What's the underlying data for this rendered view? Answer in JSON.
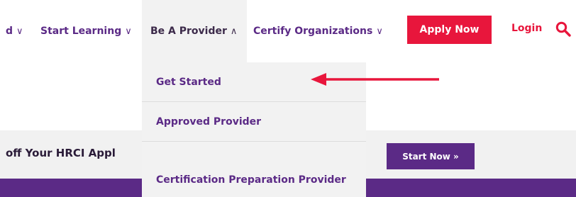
{
  "nav": {
    "items": [
      {
        "label": "d",
        "chevron": "∨"
      },
      {
        "label": "Start Learning",
        "chevron": "∨"
      },
      {
        "label": "Be A Provider",
        "chevron": "∧"
      },
      {
        "label": "Certify Organizations",
        "chevron": "∨"
      }
    ],
    "apply_label": "Apply Now",
    "login_label": "Login",
    "search_icon": "search-icon"
  },
  "dropdown": {
    "items": [
      {
        "label": "Get Started"
      },
      {
        "label": "Approved Provider"
      },
      {
        "label": "Certification Preparation Provider"
      }
    ]
  },
  "banner": {
    "text": "off Your HRCI Appl",
    "button_label": "Start Now »"
  },
  "colors": {
    "brand_purple": "#5b2a86",
    "accent_red": "#e8163c",
    "dropdown_bg": "#f2f2f2",
    "banner_bg": "#f1f1f1"
  }
}
